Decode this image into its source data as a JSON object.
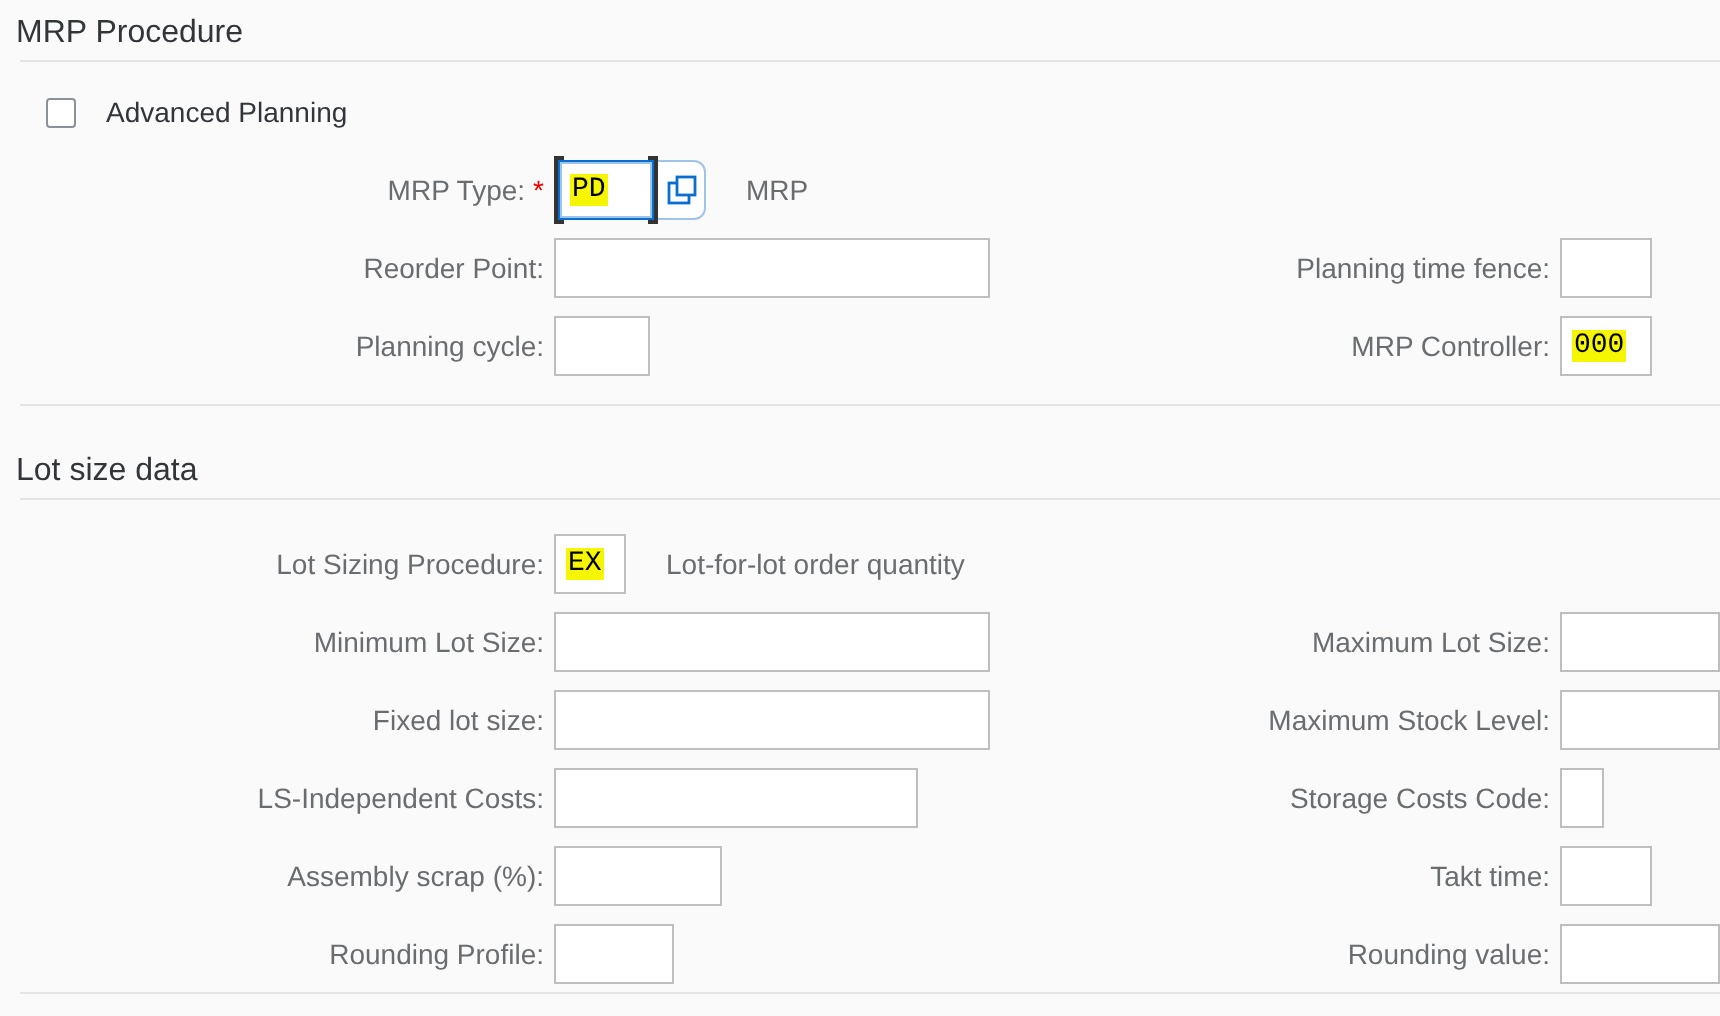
{
  "sections": [
    {
      "title": "MRP Procedure",
      "checkbox": {
        "label": "Advanced Planning",
        "checked": false
      },
      "rows": [
        {
          "left": {
            "label": "MRP Type:",
            "required_mark": "*",
            "value": "PD",
            "highlighted": true,
            "focused": true,
            "value_help": true,
            "description": "MRP"
          }
        },
        {
          "left": {
            "label": "Reorder Point:"
          },
          "right": {
            "label": "Planning time fence:"
          }
        },
        {
          "left": {
            "label": "Planning cycle:"
          },
          "right": {
            "label": "MRP Controller:",
            "value": "000",
            "highlighted": true
          }
        }
      ]
    },
    {
      "title": "Lot size data",
      "rows": [
        {
          "left": {
            "label": "Lot Sizing Procedure:",
            "value": "EX",
            "highlighted": true,
            "description": "Lot-for-lot order quantity"
          }
        },
        {
          "left": {
            "label": "Minimum Lot Size:"
          },
          "right": {
            "label": "Maximum Lot Size:"
          }
        },
        {
          "left": {
            "label": "Fixed lot size:"
          },
          "right": {
            "label": "Maximum Stock Level:"
          }
        },
        {
          "left": {
            "label": "LS-Independent Costs:"
          },
          "right": {
            "label": "Storage Costs Code:"
          }
        },
        {
          "left": {
            "label": "Assembly scrap (%):"
          },
          "right": {
            "label": "Takt time:"
          }
        },
        {
          "left": {
            "label": "Rounding Profile:"
          },
          "right": {
            "label": "Rounding value:"
          }
        }
      ]
    }
  ]
}
